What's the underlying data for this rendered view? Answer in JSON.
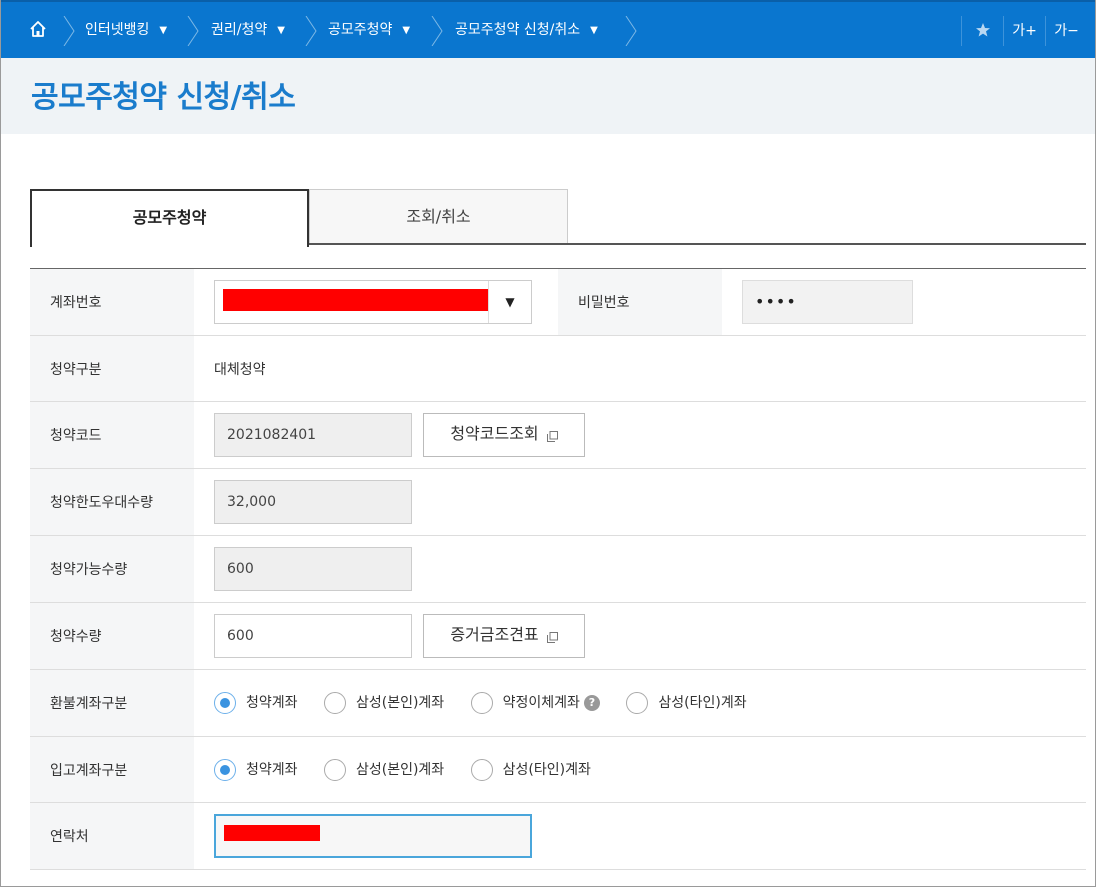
{
  "nav": {
    "breadcrumbs": [
      {
        "label": "인터넷뱅킹"
      },
      {
        "label": "권리/청약"
      },
      {
        "label": "공모주청약"
      },
      {
        "label": "공모주청약 신청/취소"
      }
    ],
    "font_up": "가+",
    "font_down": "가−",
    "icons": {
      "home": "home-icon",
      "favorite": "star-icon"
    }
  },
  "page_title": "공모주청약 신청/취소",
  "tabs": [
    {
      "label": "공모주청약",
      "active": true
    },
    {
      "label": "조회/취소",
      "active": false
    }
  ],
  "form": {
    "account": {
      "label": "계좌번호",
      "value_redacted": true
    },
    "password": {
      "label": "비밀번호",
      "value": "••••"
    },
    "sub_type": {
      "label": "청약구분",
      "value": "대체청약"
    },
    "sub_code": {
      "label": "청약코드",
      "value": "2021082401",
      "button": "청약코드조회"
    },
    "limit_qty": {
      "label": "청약한도우대수량",
      "value": "32,000"
    },
    "avail_qty": {
      "label": "청약가능수량",
      "value": "600"
    },
    "sub_qty": {
      "label": "청약수량",
      "value": "600",
      "button": "증거금조견표"
    },
    "refund": {
      "label": "환불계좌구분",
      "options": [
        "청약계좌",
        "삼성(본인)계좌",
        "약정이체계좌",
        "삼성(타인)계좌"
      ],
      "selected": "청약계좌"
    },
    "deposit": {
      "label": "입고계좌구분",
      "options": [
        "청약계좌",
        "삼성(본인)계좌",
        "삼성(타인)계좌"
      ],
      "selected": "청약계좌"
    },
    "contact": {
      "label": "연락처",
      "value_redacted": true
    }
  },
  "colors": {
    "nav_bg": "#0a76cf",
    "title": "#1a7ccc",
    "radio_on": "#3a93e0",
    "redaction": "#ff0000"
  }
}
